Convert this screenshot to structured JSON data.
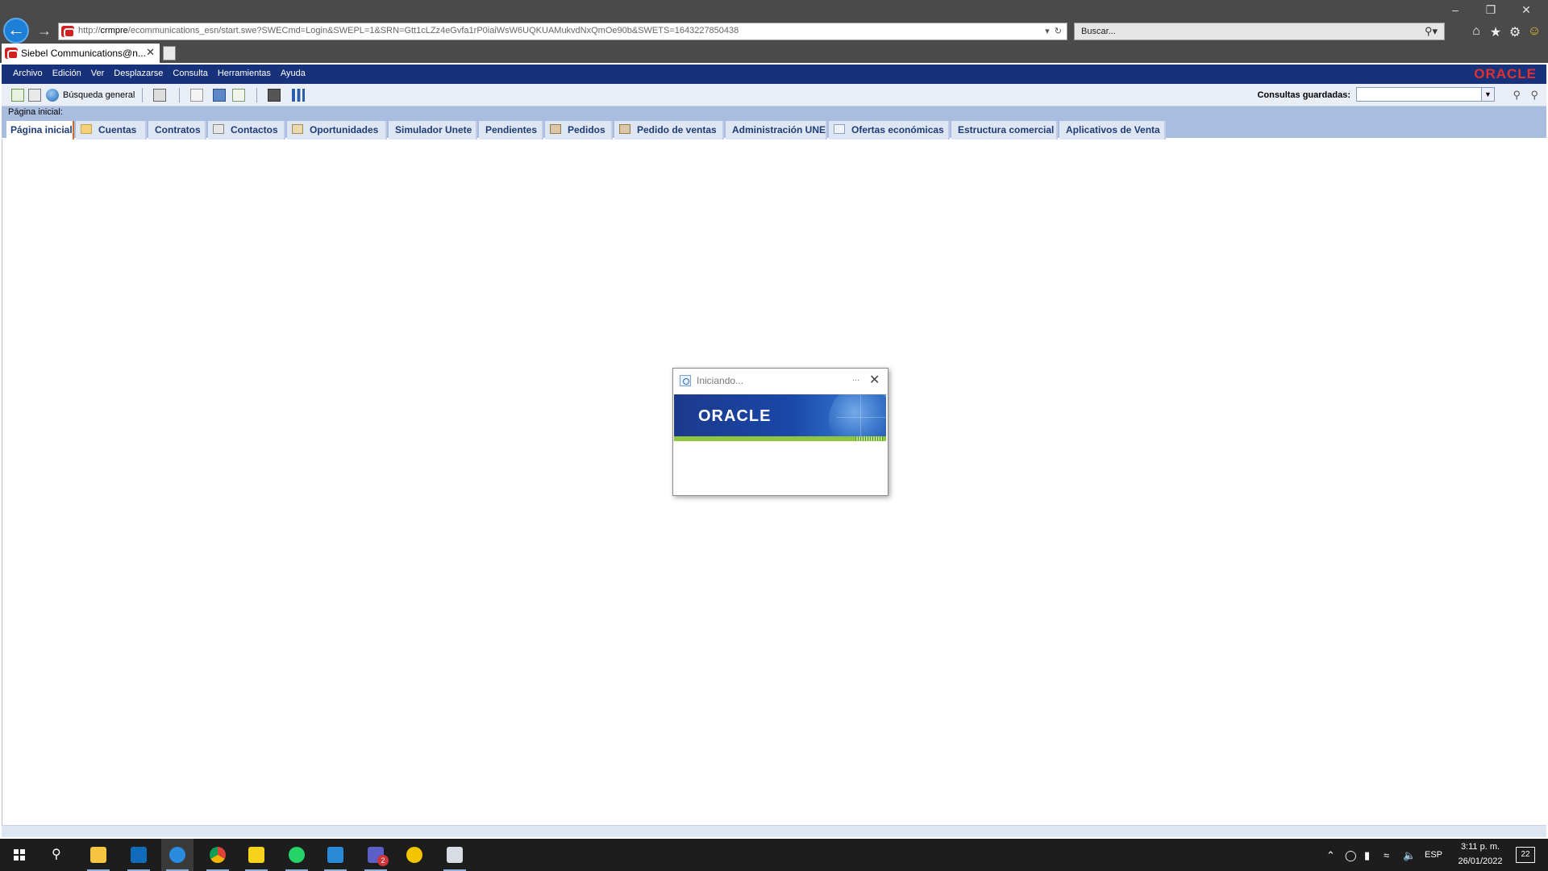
{
  "browser": {
    "address_prefix": "http://",
    "address_host": "crmpre",
    "address_rest": "/ecommunications_esn/start.swe?SWECmd=Login&SWEPL=1&SRN=Gtt1cLZz4eGvfa1rP0iaiWsW6UQKUAMukvdNxQmOe90b&SWETS=1643227850438",
    "search_placeholder": "Buscar...",
    "tab_title": "Siebel Communications@n...",
    "icons": [
      "back-arrow-icon",
      "forward-arrow-icon",
      "refresh-icon",
      "home-icon",
      "favorites-star-icon",
      "settings-gear-icon",
      "smiley-feedback-icon"
    ]
  },
  "app": {
    "menu": [
      "Archivo",
      "Edición",
      "Ver",
      "Desplazarse",
      "Consulta",
      "Herramientas",
      "Ayuda"
    ],
    "brand": "ORACLE",
    "toolbar": {
      "search_label": "Búsqueda general",
      "saved_queries_label": "Consultas guardadas:",
      "saved_queries_value": ""
    },
    "breadcrumb": "Página inicial:",
    "screen_tabs": [
      "Página inicial",
      "Cuentas",
      "Contratos",
      "Contactos",
      "Oportunidades",
      "Simulador Unete",
      "Pendientes",
      "Pedidos",
      "Pedido de ventas",
      "Administración UNE",
      "Ofertas económicas",
      "Estructura comercial",
      "Aplicativos de Venta"
    ],
    "active_tab": "Página inicial"
  },
  "popup": {
    "title": "Iniciando...",
    "dots": "...",
    "brand": "ORACLE"
  },
  "taskbar": {
    "apps": [
      "file-explorer",
      "outlook",
      "internet-explorer",
      "chrome",
      "sticky-notes",
      "whatsapp",
      "vscode",
      "teams",
      "norton",
      "remote-desktop"
    ],
    "teams_badge": "2",
    "language": "ESP",
    "time": "3:11 p. m.",
    "date": "26/01/2022",
    "notification_count": "22"
  },
  "colors": {
    "siebel_navy": "#17327a",
    "tab_strip": "#a9bde0",
    "tab_text": "#1e3c78",
    "active_tab_accent": "#d06b2a",
    "oracle_red": "#e23030"
  }
}
